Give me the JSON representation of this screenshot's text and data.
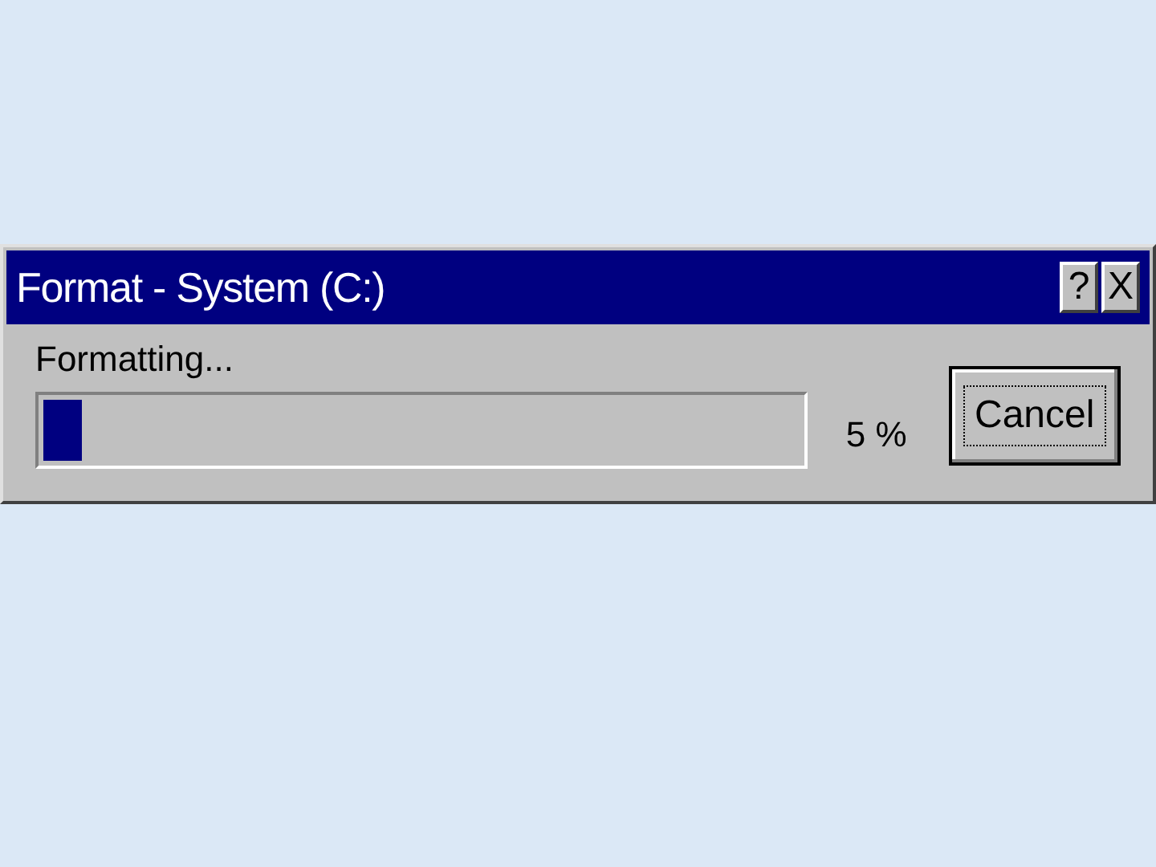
{
  "window": {
    "title": "Format - System (C:)",
    "title_buttons": [
      "?",
      "X"
    ]
  },
  "status": {
    "label": "Formatting...",
    "level": 0.05,
    "reading": "5 %"
  },
  "buttons": [
    "Cancel"
  ]
}
